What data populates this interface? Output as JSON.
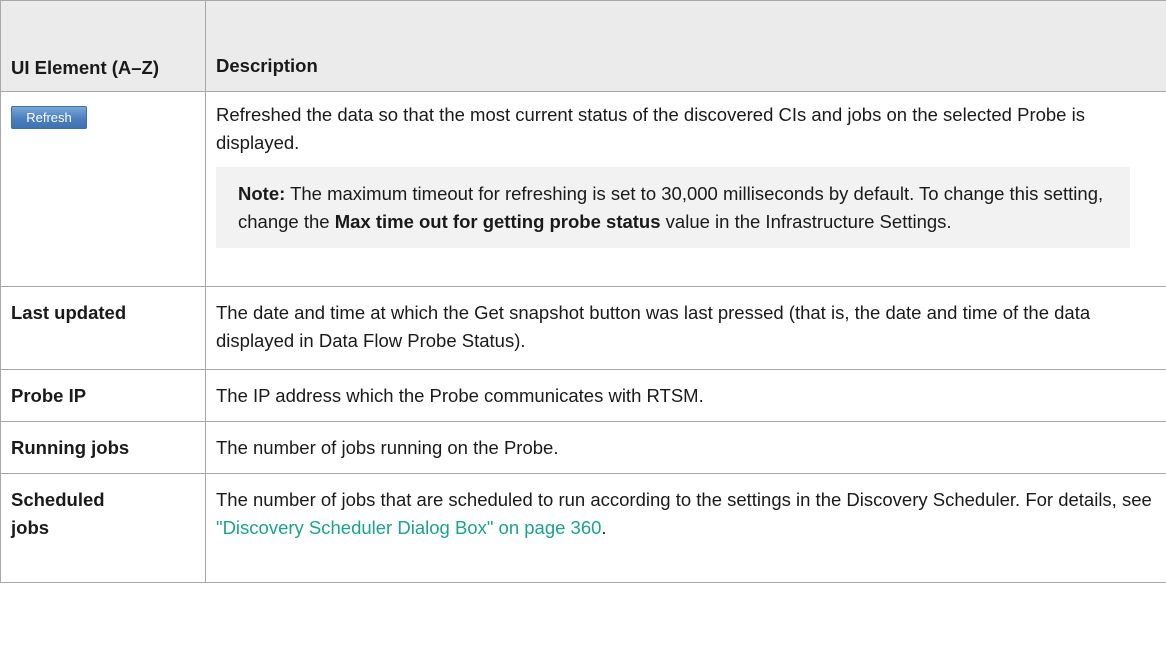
{
  "table": {
    "headers": {
      "element": "UI Element (A–Z)",
      "description": "Description"
    },
    "refresh": {
      "button_label": "Refresh",
      "description": "Refreshed the data so that the most current status of the discovered CIs and jobs on the selected Probe is displayed.",
      "note_label": "Note:",
      "note_text_1": " The maximum timeout for refreshing is set to 30,000 milliseconds by default. To change this setting, change the ",
      "note_bold_1": "Max time out for getting probe status",
      "note_text_2": " value in the Infrastructure Settings."
    },
    "rows": [
      {
        "name": "Last updated",
        "description": "The date and time at which the Get snapshot button was last pressed (that is, the date and time of the data displayed in Data Flow Probe Status)."
      },
      {
        "name": "Probe IP",
        "description": "The IP address which the Probe communicates with RTSM."
      },
      {
        "name": "Running jobs",
        "description": "The number of jobs running on the Probe."
      },
      {
        "name": "Scheduled jobs",
        "description_before": "The number of jobs that are scheduled to run according to the settings in the Discovery Scheduler. For details, see ",
        "link_text": "\"Discovery Scheduler Dialog Box\" on page 360",
        "description_after": "."
      }
    ]
  },
  "colors": {
    "header_bg": "#ebebeb",
    "note_bg": "#f2f2f2",
    "link": "#1ba38c",
    "button": "#4c7fbd"
  }
}
